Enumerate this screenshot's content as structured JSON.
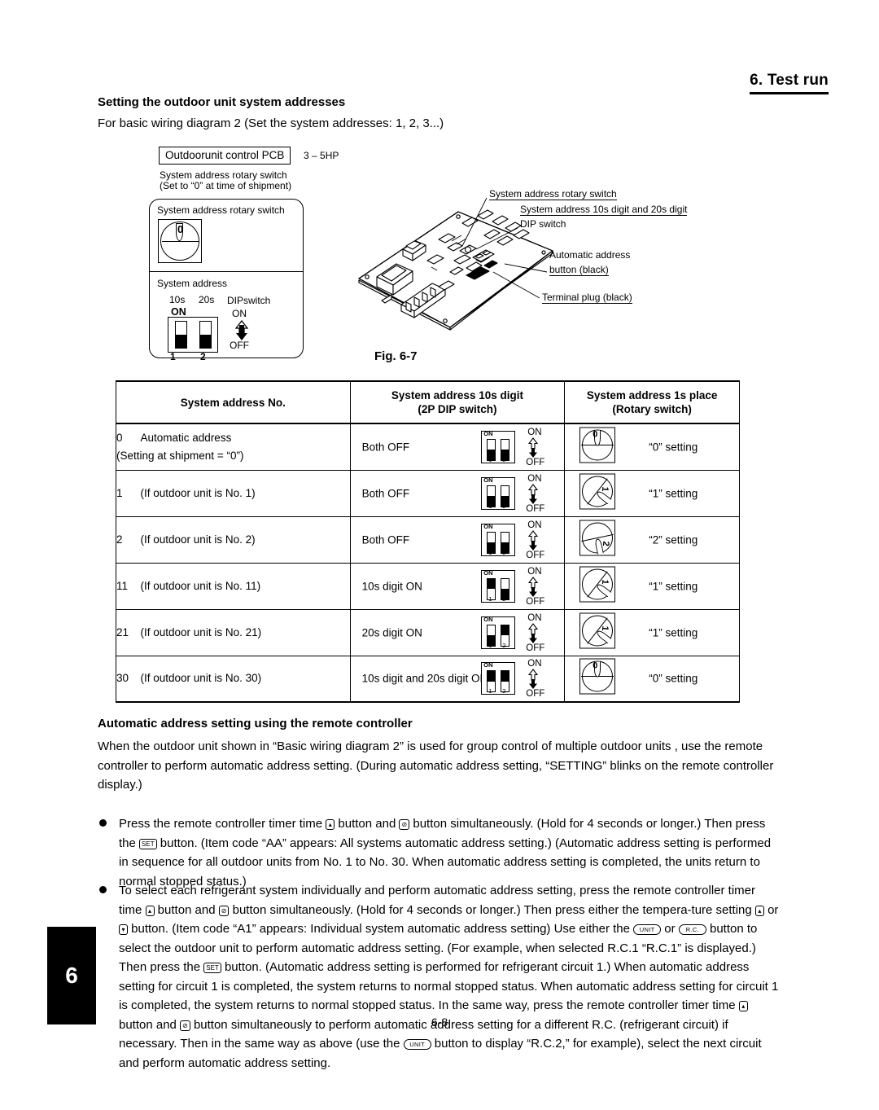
{
  "header": {
    "chapter_title": "6. Test run",
    "section_title": "Setting the outdoor unit system addresses",
    "intro": "For basic wiring diagram 2 (Set the system addresses: 1, 2, 3...)"
  },
  "figure": {
    "pcb_box_label": "Outdoorunit control PCB",
    "hp_label": "3 – 5HP",
    "rotary_note": "System address rotary switch\n(Set to “0” at time of shipment)",
    "panel": {
      "rotary_label": "System address rotary switch",
      "dial_value": "0",
      "sysaddr_label": "System address",
      "tens_label": "10s",
      "twenties_label": "20s",
      "dip_label": "DIPswitch",
      "on_label": "ON",
      "off_label": "OFF",
      "on_bold": "ON",
      "sw1_num": "1",
      "sw2_num": "2"
    },
    "callouts": [
      "System address rotary switch",
      "System address 10s digit and 20s digit",
      "DIP switch",
      "Automatic address",
      "button (black)",
      "Terminal plug (black)"
    ],
    "fig_label": "Fig. 6-7"
  },
  "table": {
    "headers": {
      "col1": "System address No.",
      "col2_line1": "System address 10s digit",
      "col2_line2": "(2P DIP switch)",
      "col3_line1": "System address 1s place",
      "col3_line2": "(Rotary switch)"
    },
    "rows": [
      {
        "no": "0",
        "desc_line1": "Automatic address",
        "desc_line2": "(Setting at shipment = “0”)",
        "dip_desc": "Both OFF",
        "sw1": "OFF",
        "sw2": "OFF",
        "dial": "0",
        "set_label": "“0” setting"
      },
      {
        "no": "1",
        "desc_line1": "(If outdoor unit is No. 1)",
        "desc_line2": "",
        "dip_desc": "Both OFF",
        "sw1": "OFF",
        "sw2": "OFF",
        "dial": "1",
        "set_label": "“1” setting"
      },
      {
        "no": "2",
        "desc_line1": "(If outdoor unit is No. 2)",
        "desc_line2": "",
        "dip_desc": "Both OFF",
        "sw1": "OFF",
        "sw2": "OFF",
        "dial": "2",
        "set_label": "“2” setting"
      },
      {
        "no": "11",
        "desc_line1": "(If outdoor unit is No. 11)",
        "desc_line2": "",
        "dip_desc": "10s digit ON",
        "sw1": "ON",
        "sw2": "OFF",
        "dial": "1",
        "set_label": "“1” setting"
      },
      {
        "no": "21",
        "desc_line1": "(If outdoor unit is No. 21)",
        "desc_line2": "",
        "dip_desc": "20s digit ON",
        "sw1": "OFF",
        "sw2": "ON",
        "dial": "1",
        "set_label": "“1” setting"
      },
      {
        "no": "30",
        "desc_line1": "(If outdoor unit is No. 30)",
        "desc_line2": "",
        "dip_desc": "10s digit and 20s digit ON",
        "sw1": "ON",
        "sw2": "ON",
        "dial": "0",
        "set_label": "“0” setting"
      }
    ],
    "dip_axis": {
      "on": "ON",
      "off": "OFF",
      "n1": "1",
      "n2": "2",
      "box_on": "ON"
    }
  },
  "body": {
    "auto_heading": "Automatic address setting using the remote controller",
    "auto_paragraph": "When the outdoor unit shown in “Basic wiring diagram 2” is used for group control of multiple outdoor units , use the remote controller to perform automatic address setting. (During automatic address setting, “SETTING” blinks on the remote controller display.)",
    "bullet1": {
      "part1": "Press the remote controller timer time",
      "btn1": "▴",
      "part2": "button and",
      "btn2": "⊘",
      "part3": "button simultaneously. (Hold for 4 seconds or longer.) Then press the",
      "btn3": "SET",
      "part4": "button. (Item code “AA” appears: All systems automatic address setting.) (Automatic address setting is performed in sequence for all outdoor units from No. 1 to No. 30. When automatic address setting is completed, the units return to normal stopped status.)"
    },
    "bullet2": {
      "part1": "To select each refrigerant system individually and perform automatic address setting, press the remote controller timer time",
      "btn1": "▴",
      "part2": "button and",
      "btn2": "⊘",
      "part3": "button simultaneously. (Hold for 4 seconds or longer.) Then press either the tempera-ture setting",
      "btn3": "▴",
      "part4": "or",
      "btn4": "▾",
      "part5": "button. (Item code “A1” appears: Individual system automatic address setting) Use either the",
      "btn5": "UNIT",
      "part6": "or",
      "btn6": "R.C.",
      "part7": "button to select the outdoor unit to perform automatic address setting. (For example, when selected R.C.1 “R.C.1” is displayed.) Then press the",
      "btn7": "SET",
      "part8": "button. (Automatic address setting is performed for refrigerant circuit 1.) When automatic address setting for circuit 1 is completed, the system returns to normal stopped status. When automatic address setting for circuit 1 is completed, the system returns to normal stopped status. In the same way, press the remote controller timer time",
      "btn8": "▴",
      "part9": "button and",
      "btn9": "⊘",
      "part10": "button simultaneously to perform automatic address setting for a different R.C. (refrigerant circuit) if necessary. Then in the same way as above (use the",
      "btn10": "UNIT",
      "part11": "button to display “R.C.2,” for example), select the next circuit and perform automatic address setting."
    }
  },
  "footer": {
    "chapter_tab": "6",
    "page_number": "6-8"
  }
}
